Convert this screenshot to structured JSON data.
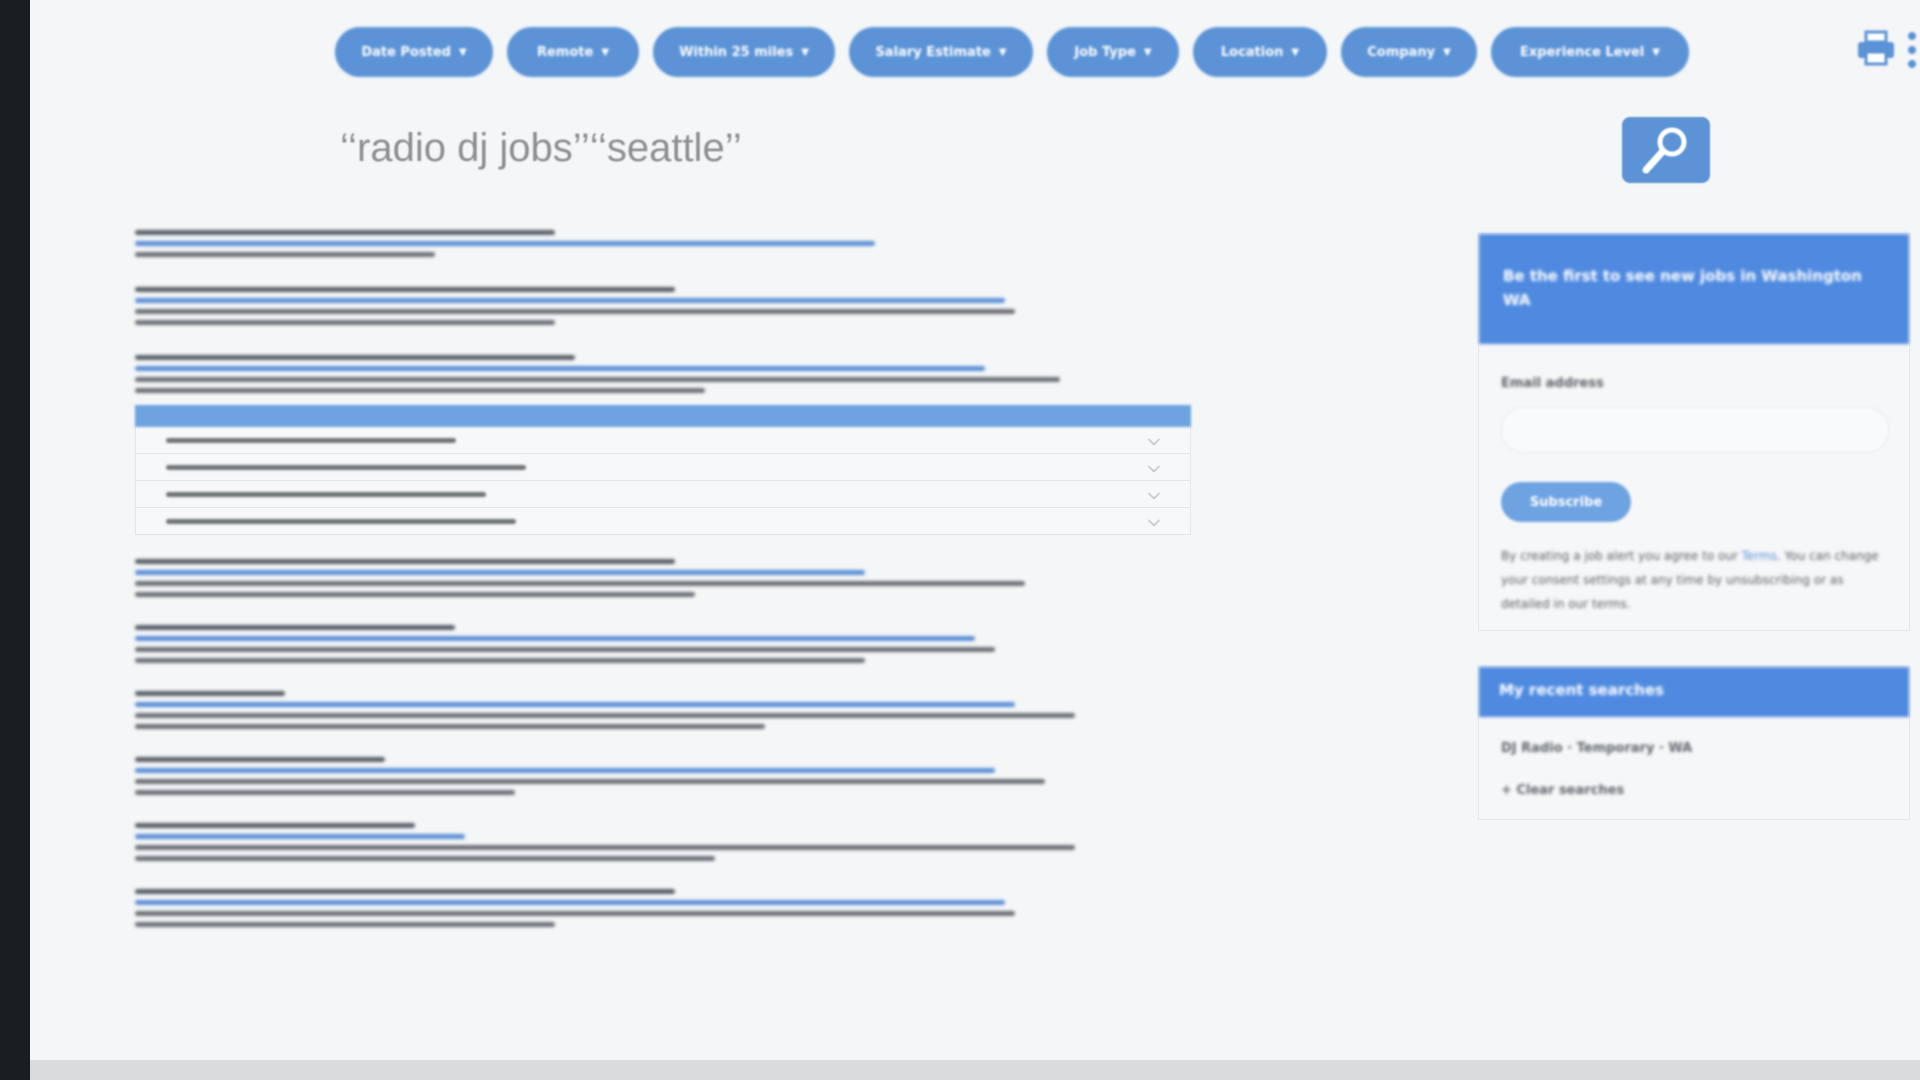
{
  "filters": [
    {
      "label": "Date Posted"
    },
    {
      "label": "Remote"
    },
    {
      "label": "Within 25 miles"
    },
    {
      "label": "Salary Estimate"
    },
    {
      "label": "Job Type"
    },
    {
      "label": "Location"
    },
    {
      "label": "Company"
    },
    {
      "label": "Experience Level"
    }
  ],
  "search": {
    "query": "‘‘radio dj jobs’’‘‘seattle’’"
  },
  "alert": {
    "heading": "Be the first to see new jobs in Washington WA",
    "email_label": "Email address",
    "subscribe_label": "Subscribe",
    "terms_before": "By creating a job alert you agree to our ",
    "terms_link": "Terms",
    "terms_after": ". You can change your consent settings at any time by unsubscribing or as detailed in our terms."
  },
  "recent": {
    "heading": "My recent searches",
    "items": [
      "DJ Radio · Temporary · WA",
      "+ Clear searches"
    ]
  },
  "colors": {
    "accent": "#5b93d6",
    "background": "#f4f6f7",
    "link": "#5c8fd8"
  },
  "icons": [
    "print-icon",
    "kebab-icon",
    "search-icon",
    "chevron-down-icon"
  ]
}
